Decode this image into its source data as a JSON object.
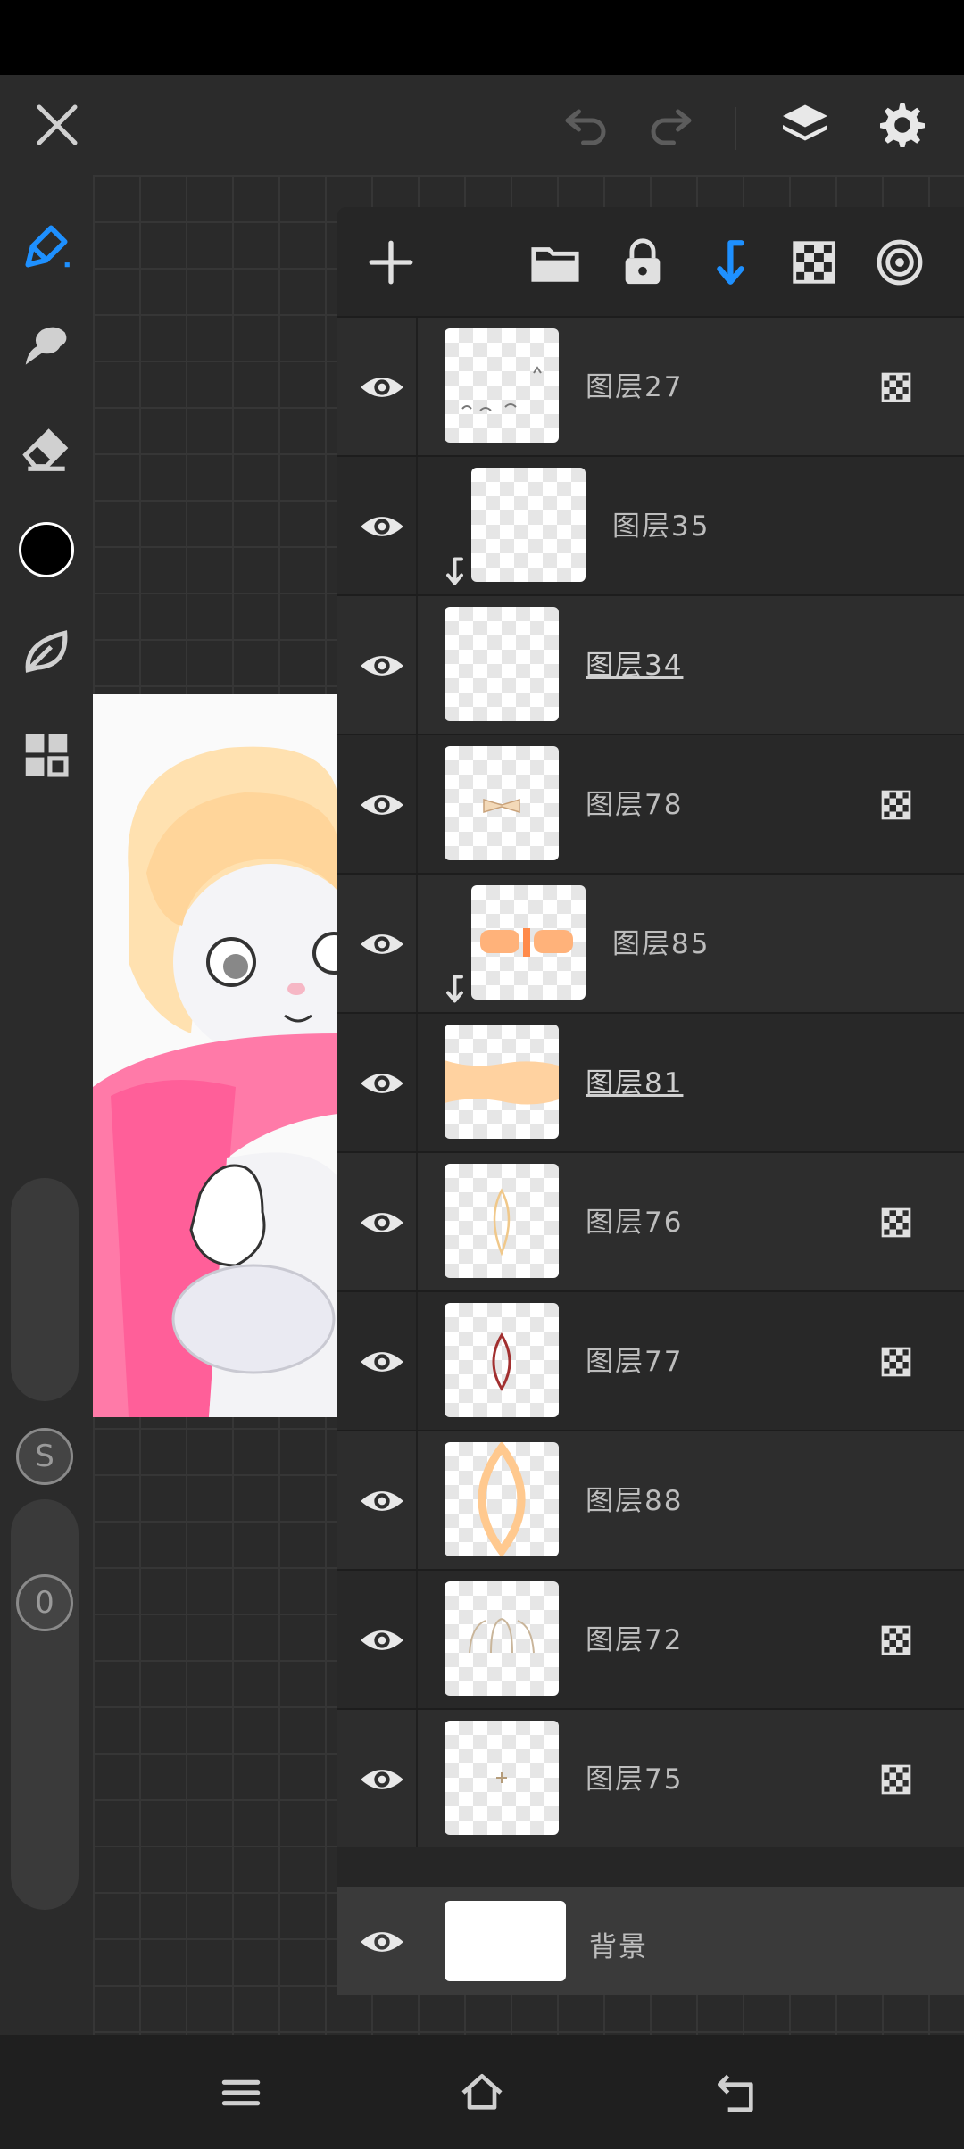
{
  "colors": {
    "accent": "#1e90ff",
    "panel": "#262626",
    "icon": "#d0d0d0"
  },
  "topbar": {
    "close_icon": "close-icon",
    "undo_icon": "undo-icon",
    "redo_icon": "redo-icon",
    "layers_icon": "layers-icon",
    "settings_icon": "gear-icon"
  },
  "tools": [
    "brush-icon",
    "smudge-icon",
    "eraser-icon",
    "color-picker",
    "leaf-icon",
    "grid-icon"
  ],
  "sliders": {
    "size_label": "S",
    "opacity_label": "0"
  },
  "panel_toolbar": [
    "add-icon",
    "folder-icon",
    "lock-icon",
    "clip-arrow-icon",
    "checker-icon",
    "target-icon"
  ],
  "layers": [
    {
      "name": "图层27",
      "clipped": false,
      "blend_icon": true,
      "active": false
    },
    {
      "name": "图层35",
      "clipped": true,
      "blend_icon": false,
      "active": false
    },
    {
      "name": "图层34",
      "clipped": false,
      "blend_icon": false,
      "active": true
    },
    {
      "name": "图层78",
      "clipped": false,
      "blend_icon": true,
      "active": false
    },
    {
      "name": "图层85",
      "clipped": true,
      "blend_icon": false,
      "active": false
    },
    {
      "name": "图层81",
      "clipped": false,
      "blend_icon": false,
      "active": true
    },
    {
      "name": "图层76",
      "clipped": false,
      "blend_icon": true,
      "active": false
    },
    {
      "name": "图层77",
      "clipped": false,
      "blend_icon": true,
      "active": false
    },
    {
      "name": "图层88",
      "clipped": false,
      "blend_icon": false,
      "active": false
    },
    {
      "name": "图层72",
      "clipped": false,
      "blend_icon": true,
      "active": false
    },
    {
      "name": "图层75",
      "clipped": false,
      "blend_icon": true,
      "active": false
    }
  ],
  "background_layer": {
    "name": "背景"
  },
  "navbar": [
    "menu-icon",
    "home-icon",
    "back-icon"
  ]
}
